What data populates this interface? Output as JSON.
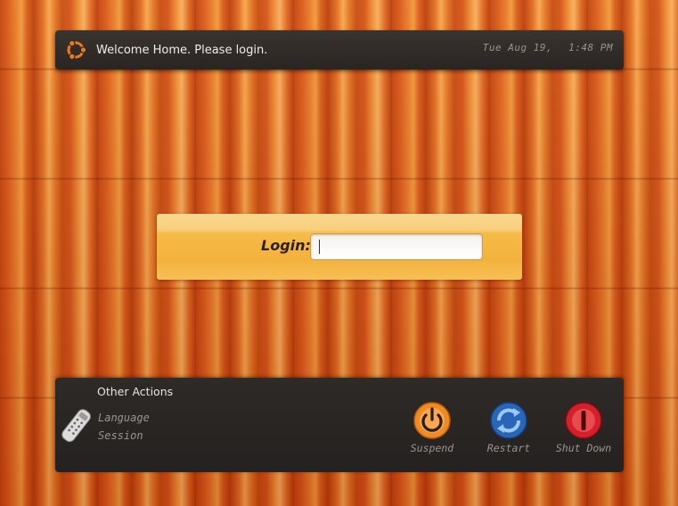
{
  "header": {
    "welcome_text": "Welcome Home. Please login.",
    "date": "Tue Aug 19,",
    "time": "1:48 PM",
    "logo_icon": "ubuntu-logo-icon"
  },
  "login": {
    "label": "Login:",
    "value": ""
  },
  "other_actions": {
    "title": "Other Actions",
    "icon": "remote-control-icon",
    "items": [
      {
        "label": "Language"
      },
      {
        "label": "Session"
      }
    ]
  },
  "power": {
    "suspend": {
      "label": "Suspend",
      "icon": "suspend-icon",
      "color": "#e8781a"
    },
    "restart": {
      "label": "Restart",
      "icon": "restart-icon",
      "color": "#3a7fd0"
    },
    "shutdown": {
      "label": "Shut Down",
      "icon": "shutdown-icon",
      "color": "#d4202a"
    }
  },
  "colors": {
    "panel_dark": "#2a2522",
    "login_accent": "#f4b23c",
    "wood_orange": "#e06a20"
  }
}
